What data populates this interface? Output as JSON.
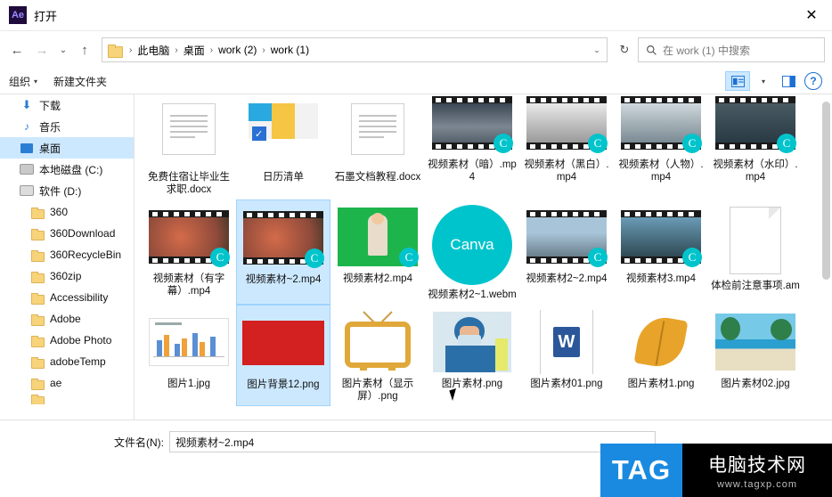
{
  "window": {
    "title": "打开",
    "app_icon_text": "Ae",
    "close_label": "✕"
  },
  "nav": {
    "back": "←",
    "forward": "→",
    "recent": "⌄",
    "up": "↑",
    "refresh": "↻",
    "crumbs": [
      "此电脑",
      "桌面",
      "work (2)",
      "work (1)"
    ],
    "crumb_sep": "›",
    "address_caret": "⌄"
  },
  "search": {
    "icon": "search-icon",
    "placeholder": "在 work (1) 中搜索"
  },
  "toolbar": {
    "organize": "组织",
    "organize_caret": "▾",
    "new_folder": "新建文件夹",
    "view_caret": "▾",
    "help": "?"
  },
  "sidebar": {
    "items": [
      {
        "label": "下载",
        "icon": "download-icon",
        "selected": false,
        "indent": false
      },
      {
        "label": "音乐",
        "icon": "music-icon",
        "selected": false,
        "indent": false
      },
      {
        "label": "桌面",
        "icon": "desktop-icon",
        "selected": true,
        "indent": false
      },
      {
        "label": "本地磁盘 (C:)",
        "icon": "disk-icon",
        "selected": false,
        "indent": false
      },
      {
        "label": "软件 (D:)",
        "icon": "disk-icon",
        "selected": false,
        "indent": false
      },
      {
        "label": "360",
        "icon": "folder-icon",
        "selected": false,
        "indent": true
      },
      {
        "label": "360Download",
        "icon": "folder-icon",
        "selected": false,
        "indent": true
      },
      {
        "label": "360RecycleBin",
        "icon": "folder-icon",
        "selected": false,
        "indent": true
      },
      {
        "label": "360zip",
        "icon": "folder-icon",
        "selected": false,
        "indent": true
      },
      {
        "label": "Accessibility",
        "icon": "folder-icon",
        "selected": false,
        "indent": true
      },
      {
        "label": "Adobe",
        "icon": "folder-icon",
        "selected": false,
        "indent": true
      },
      {
        "label": "Adobe Photo",
        "icon": "folder-icon",
        "selected": false,
        "indent": true
      },
      {
        "label": "adobeTemp",
        "icon": "folder-icon",
        "selected": false,
        "indent": true
      },
      {
        "label": "ae",
        "icon": "folder-icon",
        "selected": false,
        "indent": true
      }
    ]
  },
  "files": [
    {
      "name": "免费住宿让毕业生求职.docx",
      "kind": "doc",
      "selected": false,
      "badge": null
    },
    {
      "name": "日历清单",
      "kind": "calendar",
      "selected": false,
      "badge": null
    },
    {
      "name": "石墨文档教程.docx",
      "kind": "doc",
      "selected": false,
      "badge": null
    },
    {
      "name": "视频素材（暗）.mp4",
      "kind": "video-dark",
      "selected": false,
      "badge": "C"
    },
    {
      "name": "视频素材（黑白）.mp4",
      "kind": "video-bw",
      "selected": false,
      "badge": "C"
    },
    {
      "name": "视频素材（人物）.mp4",
      "kind": "video-person",
      "selected": false,
      "badge": "C"
    },
    {
      "name": "视频素材（水印）.mp4",
      "kind": "video-wm",
      "selected": false,
      "badge": "C"
    },
    {
      "name": "视频素材（有字幕）.mp4",
      "kind": "video-leaf",
      "selected": false,
      "badge": "C"
    },
    {
      "name": "视频素材~2.mp4",
      "kind": "video-leaf",
      "selected": true,
      "badge": "C"
    },
    {
      "name": "视频素材2.mp4",
      "kind": "video-green",
      "selected": false,
      "badge": "C"
    },
    {
      "name": "视频素材2~1.webm",
      "kind": "canva",
      "selected": false,
      "badge": null
    },
    {
      "name": "视频素材2~2.mp4",
      "kind": "video-city",
      "selected": false,
      "badge": "C"
    },
    {
      "name": "视频素材3.mp4",
      "kind": "video-glasses",
      "selected": false,
      "badge": "C"
    },
    {
      "name": "体检前注意事项.am",
      "kind": "doc-blank",
      "selected": false,
      "badge": null
    },
    {
      "name": "图片1.jpg",
      "kind": "chart",
      "selected": false,
      "badge": null
    },
    {
      "name": "图片背景12.png",
      "kind": "red",
      "selected": true,
      "badge": null
    },
    {
      "name": "图片素材（显示屏）.png",
      "kind": "tv",
      "selected": false,
      "badge": null
    },
    {
      "name": "图片素材.png",
      "kind": "doctor",
      "selected": false,
      "badge": null
    },
    {
      "name": "图片素材01.png",
      "kind": "word",
      "selected": false,
      "badge": null
    },
    {
      "name": "图片素材1.png",
      "kind": "leaf",
      "selected": false,
      "badge": null
    },
    {
      "name": "图片素材02.jpg",
      "kind": "beach",
      "selected": false,
      "badge": null
    }
  ],
  "footer": {
    "filename_label": "文件名(N):",
    "filename_value": "视频素材~2.mp4"
  },
  "watermark": {
    "tag": "TAG",
    "cn": "电脑技术网",
    "url": "www.tagxp.com"
  },
  "colors": {
    "selection": "#cce8ff",
    "canva": "#00c4cc",
    "word_blue": "#2b579a",
    "watermark_blue": "#1a8ae0"
  }
}
